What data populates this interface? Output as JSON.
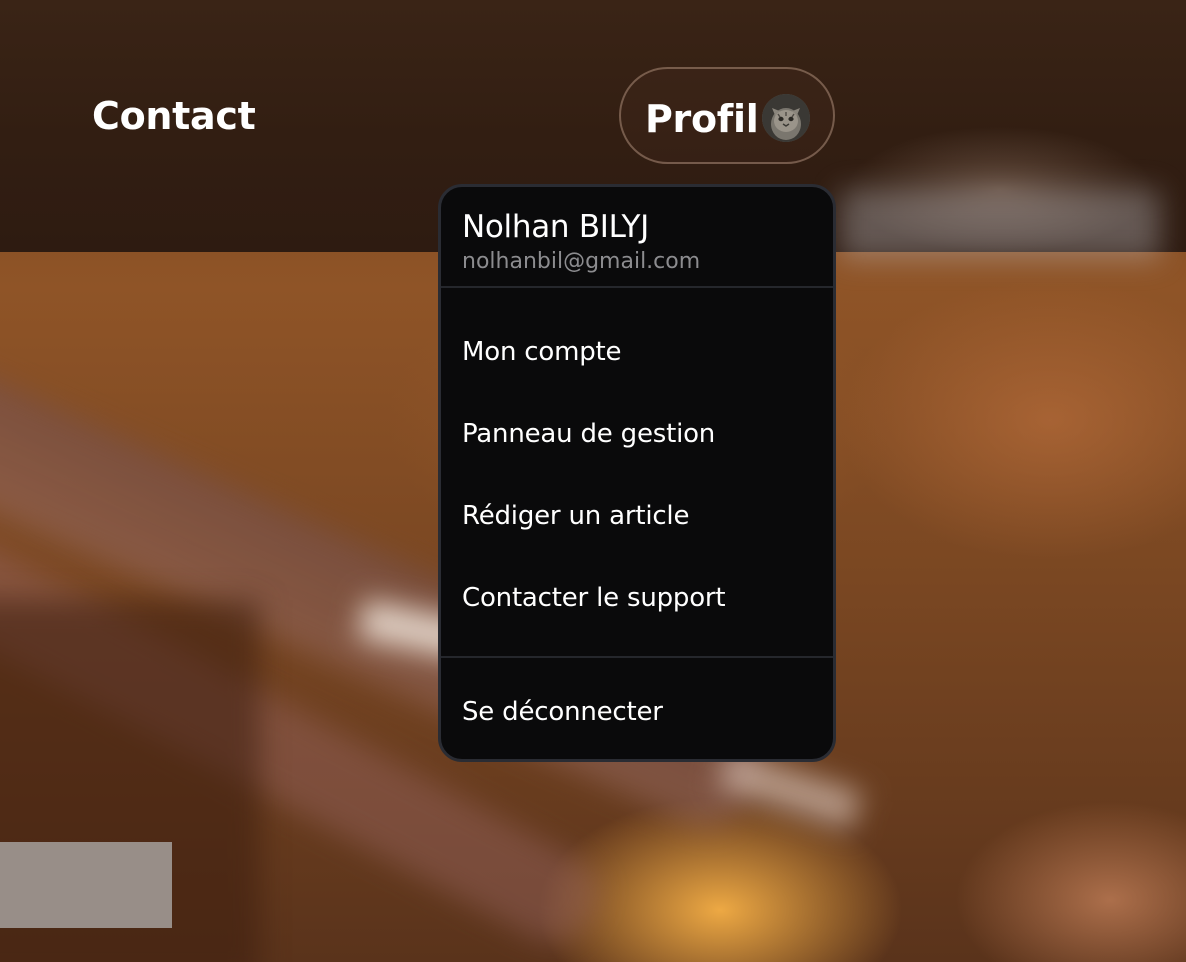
{
  "nav": {
    "contact_label": "Contact",
    "profile_label": "Profil"
  },
  "dropdown": {
    "user_name": "Nolhan BILYJ",
    "user_email": "nolhanbil@gmail.com",
    "items": [
      {
        "label": "Mon compte",
        "icon": ""
      },
      {
        "label": "Panneau de gestion",
        "icon": ""
      },
      {
        "label": "Rédiger un article",
        "icon": ""
      },
      {
        "label": "Contacter le support",
        "icon": ""
      }
    ],
    "logout_label": "Se déconnecter"
  },
  "colors": {
    "menu_background": "#0a0a0b",
    "menu_border": "#2a2c33",
    "text_primary": "#ffffff",
    "text_secondary": "#8c8c8f"
  },
  "avatar": {
    "icon": "cat-avatar-icon"
  }
}
